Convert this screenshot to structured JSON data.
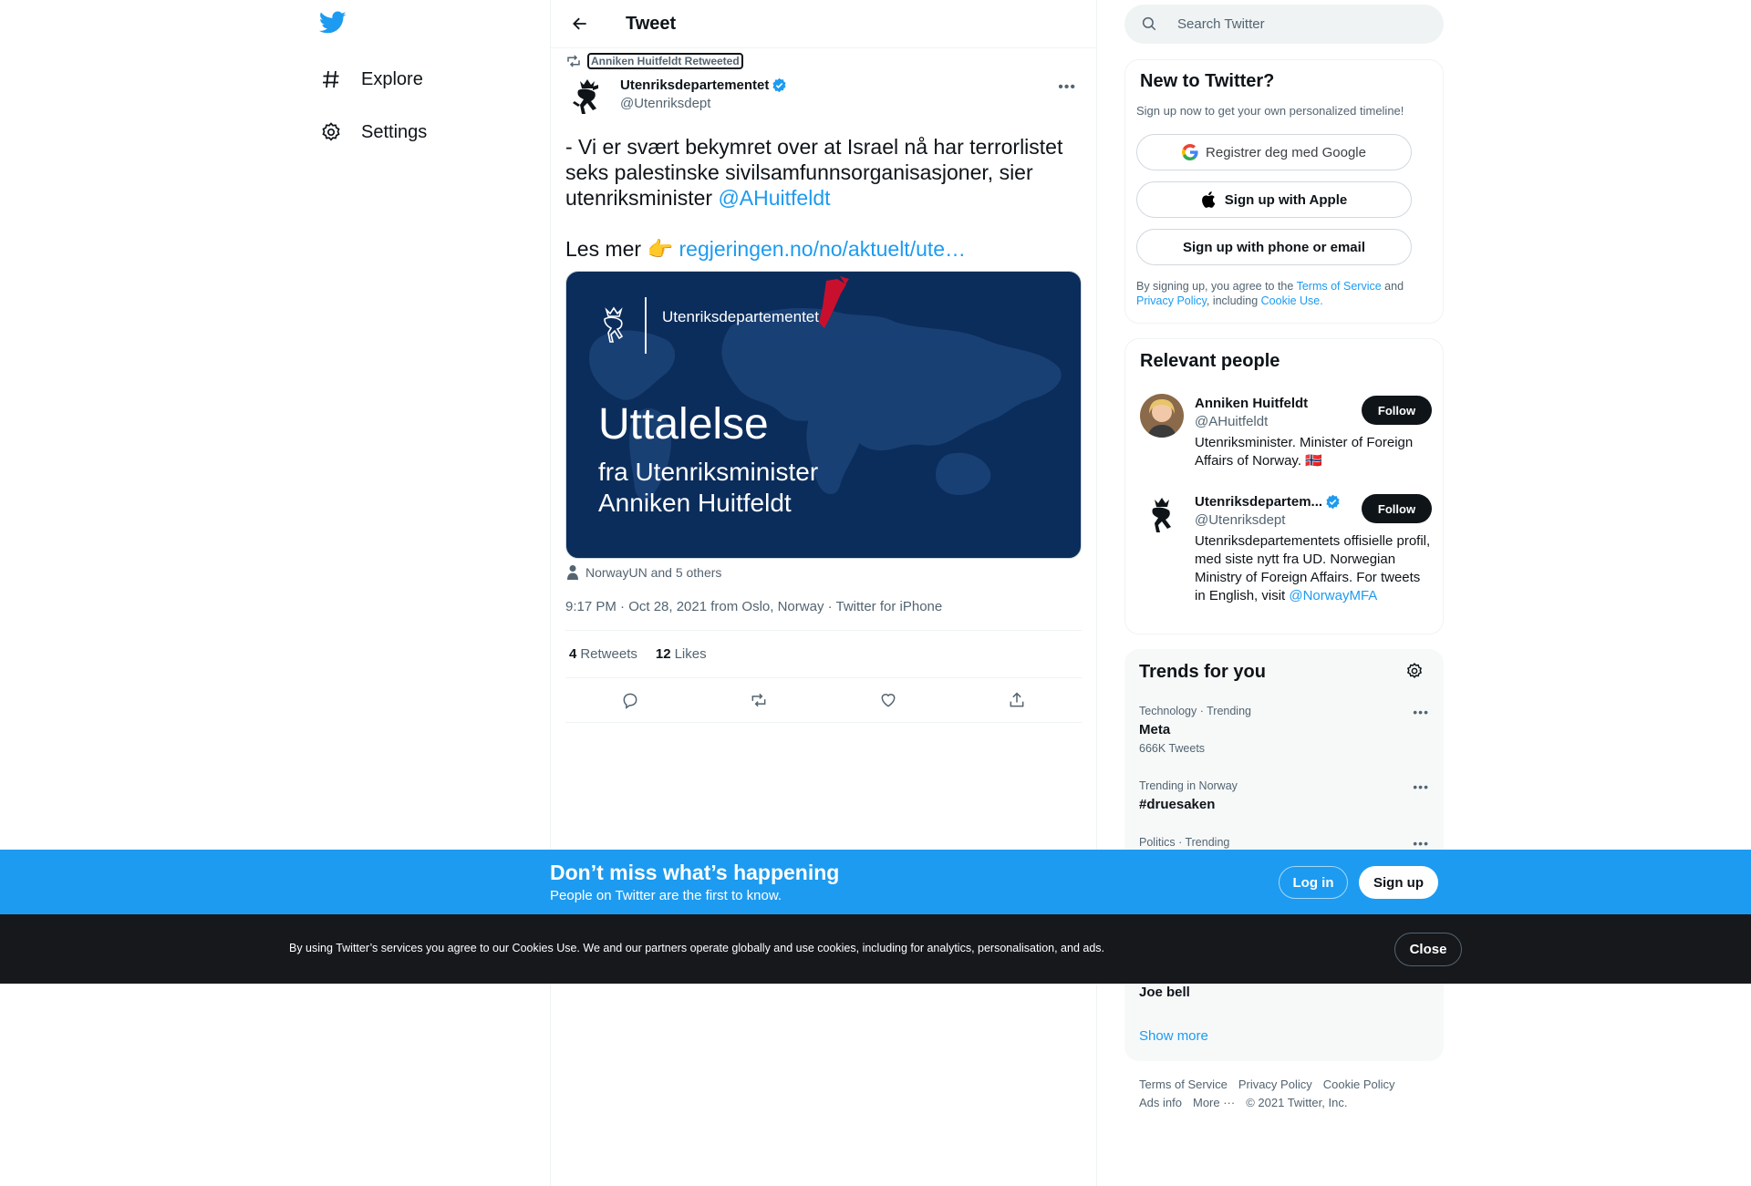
{
  "nav": {
    "logo": "twitter-bird-icon",
    "items": [
      {
        "label": "Explore",
        "icon": "hashtag-icon"
      },
      {
        "label": "Settings",
        "icon": "gear-icon"
      }
    ]
  },
  "header": {
    "title": "Tweet"
  },
  "tweet": {
    "retweeted_by": "Anniken Huitfeldt Retweeted",
    "author_name": "Utenriksdepartementet",
    "author_handle": "@Utenriksdept",
    "text_part1": "- Vi er svært bekymret over at Israel nå har terrorlistet seks palestinske sivilsamfunnsorganisasjoner, sier utenriksminister ",
    "mention": "@AHuitfeldt",
    "text_part2": "Les mer 👉 ",
    "link": "regjeringen.no/no/aktuelt/ute…",
    "media": {
      "brand": "Utenriksdepartementet",
      "heading": "Uttalelse",
      "line1": "fra Utenriksminister",
      "line2": "Anniken Huitfeldt",
      "background": "#0b2d5c"
    },
    "tagged": "NorwayUN and 5 others",
    "meta": "9:17 PM · Oct 28, 2021 from Oslo, Norway · Twitter for iPhone",
    "retweets_count": "4",
    "retweets_label": "Retweets",
    "likes_count": "12",
    "likes_label": "Likes"
  },
  "search": {
    "placeholder": "Search Twitter"
  },
  "signup": {
    "title": "New to Twitter?",
    "subtitle": "Sign up now to get your own personalized timeline!",
    "google_label": "Registrer deg med Google",
    "apple_label": "Sign up with Apple",
    "phone_label": "Sign up with phone or email",
    "terms_1": "By signing up, you agree to the ",
    "terms_link1": "Terms of Service",
    "terms_2": " and ",
    "terms_link2": "Privacy Policy",
    "terms_3": ", including ",
    "terms_link3": "Cookie Use."
  },
  "people": {
    "title": "Relevant people",
    "items": [
      {
        "name": "Anniken Huitfeldt",
        "handle": "@AHuitfeldt",
        "bio": "Utenriksminister. Minister of Foreign Affairs of Norway. 🇳🇴",
        "button": "Follow"
      },
      {
        "name": "Utenriksdepartem...",
        "handle": "@Utenriksdept",
        "bio": "Utenriksdepartementets offisielle profil, med siste nytt fra UD. Norwegian Ministry of Foreign Affairs. For tweets in English, visit ",
        "bio_link": "@NorwayMFA",
        "button": "Follow"
      }
    ]
  },
  "trends": {
    "title": "Trends for you",
    "items": [
      {
        "context": "Technology · Trending",
        "name": "Meta",
        "count": "666K Tweets"
      },
      {
        "context": "Trending in Norway",
        "name": "#druesaken",
        "count": ""
      },
      {
        "context": "Politics · Trending",
        "name": "",
        "count": ""
      },
      {
        "context": "",
        "name": "Joe bell",
        "count": ""
      }
    ],
    "show_more": "Show more"
  },
  "footer": {
    "links": [
      "Terms of Service",
      "Privacy Policy",
      "Cookie Policy",
      "Ads info",
      "More ···",
      "© 2021 Twitter, Inc."
    ]
  },
  "banner": {
    "title": "Don’t miss what’s happening",
    "subtitle": "People on Twitter are the first to know.",
    "login": "Log in",
    "signup": "Sign up"
  },
  "cookie": {
    "text": "By using Twitter’s services you agree to our Cookies Use. We and our partners operate globally and use cookies, including for analytics, personalisation, and ads.",
    "close": "Close"
  },
  "colors": {
    "accent": "#1d9bf0",
    "text": "#0f1419",
    "muted": "#536471",
    "banner": "#1d9bf0",
    "cookie_bg": "#16181c"
  }
}
